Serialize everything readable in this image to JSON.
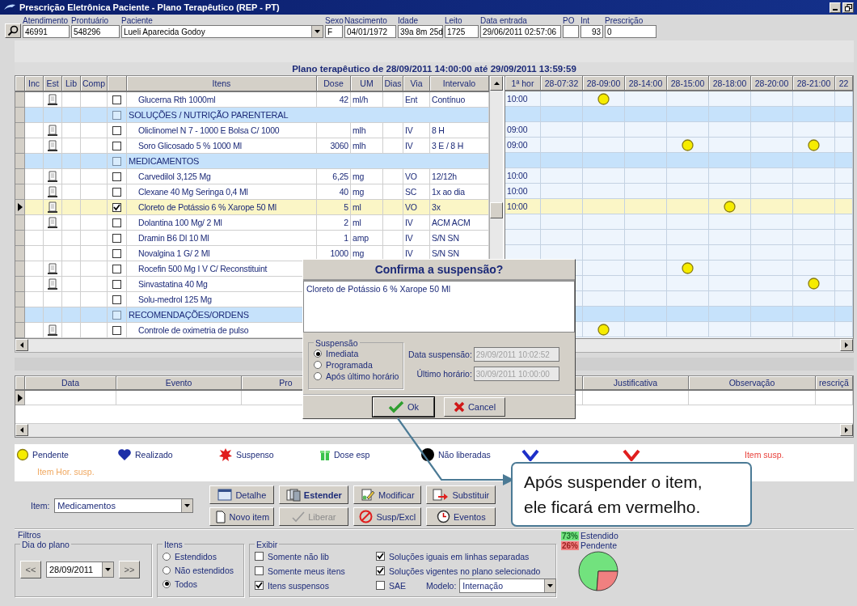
{
  "window": {
    "title": "Prescrição Eletrônica Paciente - Plano Terapêutico (REP - PT)"
  },
  "header": {
    "fields": [
      {
        "label": "Atendimento",
        "value": "46991",
        "kind": "text"
      },
      {
        "label": "Prontuário",
        "value": "548296",
        "kind": "text"
      },
      {
        "label": "Paciente",
        "value": "Lueli Aparecida Godoy",
        "kind": "combo"
      },
      {
        "label": "Sexo",
        "value": "F",
        "kind": "text"
      },
      {
        "label": "Nascimento",
        "value": "04/01/1972",
        "kind": "text"
      },
      {
        "label": "Idade",
        "value": "39a 8m 25d",
        "kind": "text"
      },
      {
        "label": "Leito",
        "value": "1725",
        "kind": "text"
      },
      {
        "label": "Data entrada",
        "value": "29/06/2011 02:57:06",
        "kind": "text"
      },
      {
        "label": "PO",
        "kind": "text"
      },
      {
        "label": "Int",
        "value": "93",
        "kind": "number"
      },
      {
        "label": "Prescrição",
        "value": "0",
        "kind": "text"
      }
    ]
  },
  "plan": {
    "title": "Plano terapêutico de 28/09/2011 14:00:00 até 29/09/2011 13:59:59",
    "columns": [
      "Inc",
      "Est",
      "Lib",
      "Comp",
      "Itens",
      "Dose",
      "UM",
      "Dias",
      "Via",
      "Intervalo"
    ],
    "schedule_columns": [
      "1ª hor",
      "28-07:32",
      "28-09:00",
      "28-14:00",
      "28-15:00",
      "28-18:00",
      "28-20:00",
      "28-21:00",
      "22"
    ],
    "rows": [
      {
        "kind": "item",
        "item": "Glucerna Rth 1000ml",
        "dose": "42",
        "um": "ml/h",
        "via": "Ent",
        "interval": "Contínuo",
        "first": "10:00",
        "document": true,
        "checked": false,
        "selected": false,
        "pending": [
          false,
          true,
          false,
          false,
          false,
          false,
          false,
          false
        ]
      },
      {
        "kind": "section",
        "label": "SOLUÇÕES / NUTRIÇÃO PARENTERAL",
        "checked": false,
        "selected": false
      },
      {
        "kind": "item",
        "item": "Oliclinomel N 7 - 1000 E Bolsa C/ 1000",
        "um": "mlh",
        "via": "IV",
        "interval": "8 H",
        "first": "09:00",
        "document": true,
        "checked": false,
        "selected": false,
        "pending": [
          false,
          false,
          false,
          false,
          false,
          false,
          false,
          false
        ]
      },
      {
        "kind": "item",
        "item": "Soro Glicosado 5 % 1000 Ml",
        "dose": "3060",
        "um": "mlh",
        "via": "IV",
        "interval": "3 E / 8 H",
        "first": "09:00",
        "document": true,
        "checked": false,
        "selected": false,
        "pending": [
          false,
          false,
          false,
          true,
          false,
          false,
          true,
          false
        ]
      },
      {
        "kind": "section",
        "label": "MEDICAMENTOS",
        "checked": false,
        "selected": false
      },
      {
        "kind": "item",
        "item": "Carvedilol 3,125 Mg",
        "dose": "6,25",
        "um": "mg",
        "via": "VO",
        "interval": "12/12h",
        "first": "10:00",
        "document": true,
        "checked": false,
        "selected": false,
        "pending": [
          false,
          false,
          false,
          false,
          false,
          false,
          false,
          false
        ]
      },
      {
        "kind": "item",
        "item": "Clexane 40 Mg Seringa 0,4 Ml",
        "dose": "40",
        "um": "mg",
        "via": "SC",
        "interval": "1x ao dia",
        "first": "10:00",
        "document": true,
        "checked": false,
        "selected": false,
        "pending": [
          false,
          false,
          false,
          false,
          false,
          false,
          false,
          false
        ]
      },
      {
        "kind": "item",
        "item": "Cloreto de Potássio 6 % Xarope 50 Ml",
        "dose": "5",
        "um": "ml",
        "via": "VO",
        "interval": "3x",
        "first": "10:00",
        "document": true,
        "checked": true,
        "selected": true,
        "pending": [
          false,
          false,
          false,
          false,
          true,
          false,
          false,
          false
        ]
      },
      {
        "kind": "item",
        "item": "Dolantina 100 Mg/ 2 Ml",
        "dose": "2",
        "um": "ml",
        "via": "IV",
        "interval": "ACM ACM",
        "document": true,
        "checked": false,
        "selected": false,
        "pending": [
          false,
          false,
          false,
          false,
          false,
          false,
          false,
          false
        ]
      },
      {
        "kind": "item",
        "item": "Dramin B6 Dl 10 Ml",
        "dose": "1",
        "um": "amp",
        "via": "IV",
        "interval": "S/N SN",
        "document": false,
        "checked": false,
        "selected": false,
        "pending": [
          false,
          false,
          false,
          false,
          false,
          false,
          false,
          false
        ]
      },
      {
        "kind": "item",
        "item": "Novalgina 1 G/ 2 Ml",
        "dose": "1000",
        "um": "mg",
        "via": "IV",
        "interval": "S/N SN",
        "document": false,
        "checked": false,
        "selected": false,
        "pending": [
          false,
          false,
          false,
          false,
          false,
          false,
          false,
          false
        ]
      },
      {
        "kind": "item",
        "item": "Rocefin 500 Mg I V C/ Reconstituint",
        "document": true,
        "checked": false,
        "selected": false,
        "pending": [
          false,
          false,
          false,
          true,
          false,
          false,
          false,
          false
        ]
      },
      {
        "kind": "item",
        "item": "Sinvastatina 40 Mg",
        "document": true,
        "checked": false,
        "selected": false,
        "pending": [
          false,
          false,
          false,
          false,
          false,
          false,
          true,
          false
        ]
      },
      {
        "kind": "item",
        "item": "Solu-medrol 125 Mg",
        "document": false,
        "checked": false,
        "selected": false,
        "pending": [
          false,
          false,
          false,
          false,
          false,
          false,
          false,
          false
        ]
      },
      {
        "kind": "section",
        "label": "RECOMENDAÇÕES/ORDENS",
        "checked": false,
        "selected": false
      },
      {
        "kind": "item",
        "item": "Controle de oximetria de pulso",
        "document": true,
        "checked": false,
        "selected": false,
        "pending": [
          false,
          true,
          false,
          false,
          false,
          false,
          false,
          false
        ]
      }
    ]
  },
  "events": {
    "columns": [
      "Data",
      "Evento",
      "Pro",
      "Justificativa",
      "Observação",
      "rescriçã"
    ]
  },
  "legend": [
    {
      "kind": "pending",
      "label": "Pendente"
    },
    {
      "kind": "done",
      "label": "Realizado"
    },
    {
      "kind": "suspended",
      "label": "Suspenso"
    },
    {
      "kind": "dose",
      "label": "Dose esp"
    },
    {
      "kind": "unreleased",
      "label": "Não liberadas"
    },
    {
      "kind": "released"
    },
    {
      "kind": "late"
    },
    {
      "kind": "text",
      "label": "Item susp.",
      "color": "#e8403a"
    },
    {
      "kind": "text",
      "label": "Item Hor. susp.",
      "color": "#f0a860"
    }
  ],
  "item_select": {
    "label": "Item:",
    "value": "Medicamentos"
  },
  "buttons": [
    {
      "label": "Detalhe",
      "kind": "detail",
      "primary": false,
      "disabled": false
    },
    {
      "label": "Estender",
      "kind": "extend",
      "primary": true,
      "disabled": false
    },
    {
      "label": "Modificar",
      "kind": "modify",
      "primary": false,
      "disabled": false
    },
    {
      "label": "Substituir",
      "kind": "replace",
      "primary": false,
      "disabled": false
    },
    {
      "label": "Novo item",
      "kind": "new",
      "primary": false,
      "disabled": false
    },
    {
      "label": "Liberar",
      "kind": "release",
      "primary": false,
      "disabled": true
    },
    {
      "label": "Susp/Excl",
      "kind": "suspend",
      "primary": false,
      "disabled": false
    },
    {
      "label": "Eventos",
      "kind": "events",
      "primary": false,
      "disabled": false
    }
  ],
  "filters": {
    "title": "Filtros",
    "day": {
      "title": "Dia do plano",
      "prev": "<<",
      "date": "28/09/2011",
      "next": ">>"
    },
    "items": {
      "title": "Itens",
      "options": [
        {
          "label": "Estendidos",
          "selected": false
        },
        {
          "label": "Não estendidos",
          "selected": false
        },
        {
          "label": "Todos",
          "selected": true
        }
      ]
    },
    "show": {
      "title": "Exibir",
      "options": [
        {
          "label": "Somente não lib",
          "checked": false
        },
        {
          "label": "Soluções iguais em linhas separadas",
          "checked": true
        },
        {
          "label": "Somente meus itens",
          "checked": false
        },
        {
          "label": "Soluções vigentes no plano selecionado",
          "checked": true
        },
        {
          "label": "Itens suspensos",
          "checked": true
        },
        {
          "label": "SAE",
          "checked": false
        }
      ],
      "model": {
        "label": "Modelo:",
        "value": "Internação"
      }
    },
    "chart_data": {
      "type": "pie",
      "categories": [
        "Estendido",
        "Pendente"
      ],
      "series": [
        {
          "values": [
            73,
            26
          ]
        }
      ],
      "value_labels": [
        "73%",
        "26%"
      ],
      "legend": "top"
    }
  },
  "dialog": {
    "title": "Confirma a suspensão?",
    "text": "Cloreto de Potássio 6 % Xarope 50 Ml",
    "group": "Suspensão",
    "options": [
      {
        "label": "Imediata",
        "selected": true
      },
      {
        "label": "Programada",
        "selected": false
      },
      {
        "label": "Após último horário",
        "selected": false
      }
    ],
    "fields": [
      {
        "label": "Data suspensão:",
        "value": "29/09/2011 10:02:52",
        "disabled": true
      },
      {
        "label": "Último horário:",
        "value": "30/09/2011 10:00:00",
        "disabled": true
      }
    ],
    "buttons": [
      {
        "label": "Ok",
        "kind": "ok"
      },
      {
        "label": "Cancel",
        "kind": "cancel"
      }
    ]
  },
  "callout": {
    "text": "Após suspender o item, ele ficará em vermelho."
  }
}
